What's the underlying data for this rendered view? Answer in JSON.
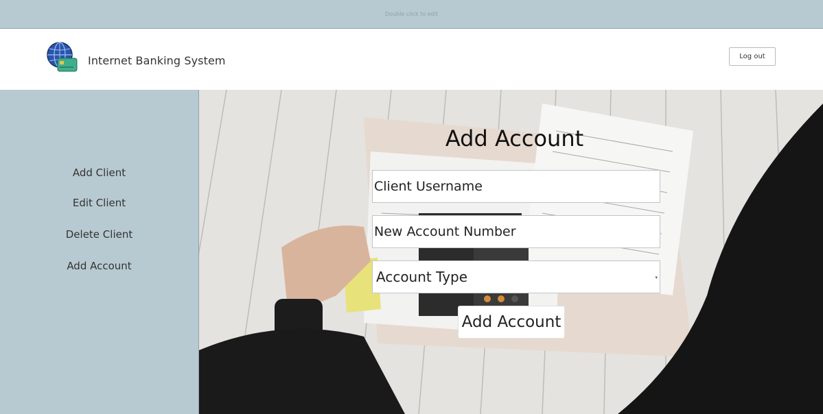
{
  "topbar": {
    "hint": "Double click to edit"
  },
  "header": {
    "brand": "Internet Banking System",
    "logout_label": "Log out"
  },
  "sidebar": {
    "items": [
      {
        "label": "Add Client"
      },
      {
        "label": "Edit Client"
      },
      {
        "label": "Delete Client"
      },
      {
        "label": "Add Account"
      }
    ]
  },
  "form": {
    "title": "Add Account",
    "username_placeholder": "Client Username",
    "account_number_placeholder": "New Account Number",
    "account_type_selected": "Account Type",
    "submit_label": "Add Account"
  },
  "colors": {
    "panel": "#b8cad1",
    "header_bg": "#ffffff",
    "text": "#333333"
  },
  "icons": {
    "logo": "globe-card-icon",
    "select_caret": "chevron-down-icon"
  }
}
